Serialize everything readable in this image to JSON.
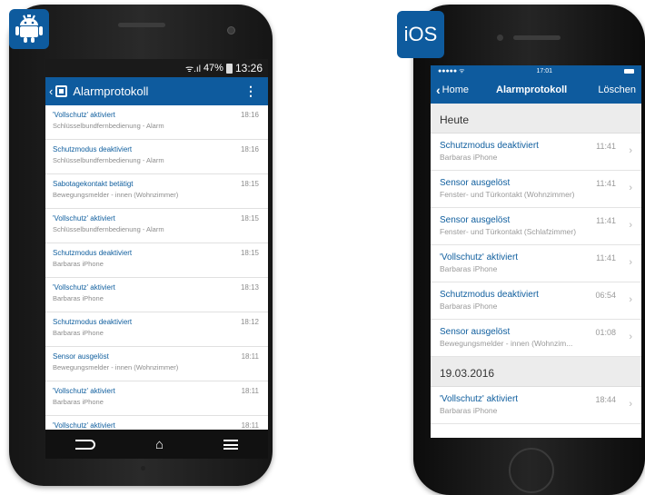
{
  "android": {
    "badge_icon": "android-robot-icon",
    "status": {
      "signal": "ᯤ.ıl",
      "battery_pct": "47%",
      "time": "13:26"
    },
    "appbar": {
      "title": "Alarmprotokoll",
      "menu_icon": "more-vert-icon"
    },
    "items": [
      {
        "title": "'Vollschutz' aktiviert",
        "subtitle": "Schlüsselbundfernbedienung - Alarm",
        "time": "18:16"
      },
      {
        "title": "Schutzmodus deaktiviert",
        "subtitle": "Schlüsselbundfernbedienung - Alarm",
        "time": "18:16"
      },
      {
        "title": "Sabotagekontakt betätigt",
        "subtitle": "Bewegungsmelder - innen (Wohnzimmer)",
        "time": "18:15"
      },
      {
        "title": "'Vollschutz' aktiviert",
        "subtitle": "Schlüsselbundfernbedienung - Alarm",
        "time": "18:15"
      },
      {
        "title": "Schutzmodus deaktiviert",
        "subtitle": "Barbaras iPhone",
        "time": "18:15"
      },
      {
        "title": "'Vollschutz' aktiviert",
        "subtitle": "Barbaras iPhone",
        "time": "18:13"
      },
      {
        "title": "Schutzmodus deaktiviert",
        "subtitle": "Barbaras iPhone",
        "time": "18:12"
      },
      {
        "title": "Sensor ausgelöst",
        "subtitle": "Bewegungsmelder - innen (Wohnzimmer)",
        "time": "18:11"
      },
      {
        "title": "'Vollschutz' aktiviert",
        "subtitle": "Barbaras iPhone",
        "time": "18:11"
      },
      {
        "title": "'Vollschutz' aktiviert",
        "subtitle": "",
        "time": "18:11"
      }
    ]
  },
  "ios": {
    "badge_label": "iOS",
    "status": {
      "carrier": "●●●●● ᯤ",
      "time": "17:01"
    },
    "navbar": {
      "back_label": "Home",
      "title": "Alarmprotokoll",
      "delete_label": "Löschen"
    },
    "sections": [
      {
        "header": "Heute",
        "items": [
          {
            "title": "Schutzmodus deaktiviert",
            "subtitle": "Barbaras iPhone",
            "time": "11:41"
          },
          {
            "title": "Sensor ausgelöst",
            "subtitle": "Fenster- und Türkontakt (Wohnzimmer)",
            "time": "11:41"
          },
          {
            "title": "Sensor ausgelöst",
            "subtitle": "Fenster- und Türkontakt (Schlafzimmer)",
            "time": "11:41"
          },
          {
            "title": "'Vollschutz' aktiviert",
            "subtitle": "Barbaras iPhone",
            "time": "11:41"
          },
          {
            "title": "Schutzmodus deaktiviert",
            "subtitle": "Barbaras iPhone",
            "time": "06:54"
          },
          {
            "title": "Sensor ausgelöst",
            "subtitle": "Bewegungsmelder - innen (Wohnzim...",
            "time": "01:08"
          }
        ]
      },
      {
        "header": "19.03.2016",
        "items": [
          {
            "title": "'Vollschutz' aktiviert",
            "subtitle": "Barbaras iPhone",
            "time": "18:44"
          }
        ]
      }
    ]
  },
  "colors": {
    "brand_blue": "#0e5b9e",
    "title_blue": "#0f5e9e"
  }
}
